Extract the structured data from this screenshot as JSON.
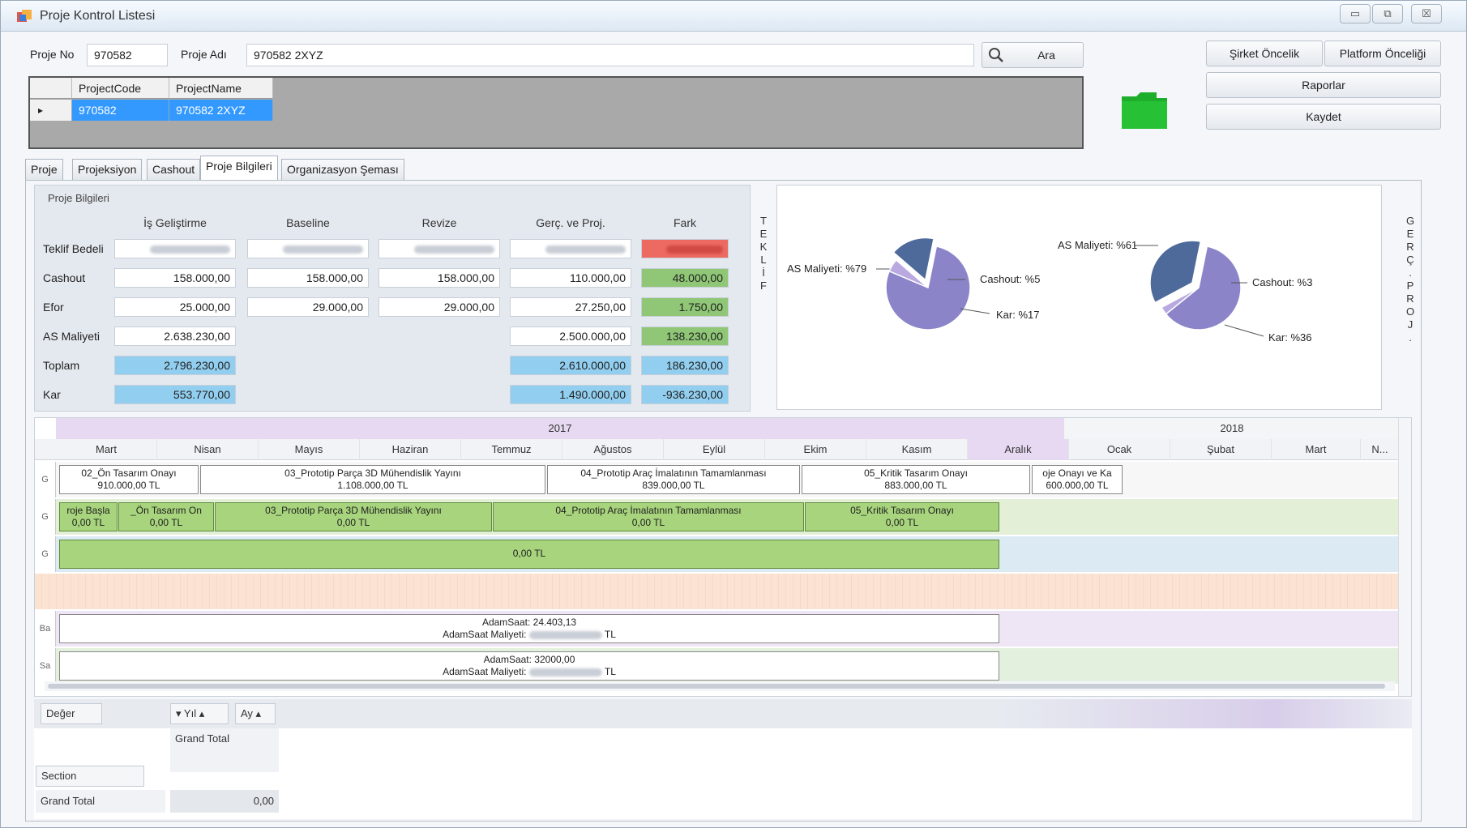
{
  "window": {
    "title": "Proje Kontrol Listesi",
    "controls": [
      "▭",
      "⧉",
      "☒"
    ]
  },
  "search": {
    "proje_no_label": "Proje No",
    "proje_no_value": "970582",
    "proje_adi_label": "Proje Adı",
    "proje_adi_value": "970582 2XYZ",
    "search_button": "Ara"
  },
  "right_buttons": {
    "sirket": "Şirket Öncelik",
    "platform": "Platform Önceliği",
    "raporlar": "Raporlar",
    "kaydet": "Kaydet"
  },
  "project_grid": {
    "columns": [
      "ProjectCode",
      "ProjectName"
    ],
    "rows": [
      [
        "970582",
        "970582 2XYZ"
      ]
    ]
  },
  "tabs": [
    "Proje",
    "Projeksiyon",
    "Cashout",
    "Proje Bilgileri",
    "Organizasyon Şeması"
  ],
  "active_tab": "Proje Bilgileri",
  "info": {
    "title": "Proje Bilgileri",
    "columns": [
      "İş Geliştirme",
      "Baseline",
      "Revize",
      "Gerç. ve Proj.",
      "Fark"
    ],
    "rows": [
      {
        "label": "Teklif Bedeli",
        "values": [
          "",
          "",
          "",
          "",
          ""
        ]
      },
      {
        "label": "Cashout",
        "values": [
          "158.000,00",
          "158.000,00",
          "158.000,00",
          "110.000,00",
          "48.000,00"
        ]
      },
      {
        "label": "Efor",
        "values": [
          "25.000,00",
          "29.000,00",
          "29.000,00",
          "27.250,00",
          "1.750,00"
        ]
      },
      {
        "label": "AS Maliyeti",
        "values": [
          "2.638.230,00",
          "",
          "",
          "2.500.000,00",
          "138.230,00"
        ]
      },
      {
        "label": "Toplam",
        "values": [
          "2.796.230,00",
          "",
          "",
          "2.610.000,00",
          "186.230,00"
        ]
      },
      {
        "label": "Kar",
        "values": [
          "553.770,00",
          "",
          "",
          "1.490.000,00",
          "-936.230,00"
        ]
      }
    ]
  },
  "side_labels": {
    "teklif": [
      "T",
      "E",
      "K",
      "L",
      "İ",
      "F"
    ],
    "gerc": [
      "G",
      "E",
      "R",
      "Ç",
      ".",
      "P",
      "R",
      "O",
      "J",
      "."
    ]
  },
  "pies": [
    {
      "slices": [
        {
          "label": "AS Maliyeti: %79",
          "value": 79,
          "color": "#8b84c9"
        },
        {
          "label": "Cashout: %5",
          "value": 5,
          "color": "#b9a9e0"
        },
        {
          "label": "Kar: %17",
          "value": 17,
          "color": "#4e6a9a"
        }
      ]
    },
    {
      "slices": [
        {
          "label": "AS Maliyeti: %61",
          "value": 61,
          "color": "#8b84c9"
        },
        {
          "label": "Cashout: %3",
          "value": 3,
          "color": "#b9a9e0"
        },
        {
          "label": "Kar: %36",
          "value": 36,
          "color": "#4e6a9a"
        }
      ]
    }
  ],
  "gantt": {
    "years": [
      "2017",
      "2018"
    ],
    "months": [
      "Mart",
      "Nisan",
      "Mayıs",
      "Haziran",
      "Temmuz",
      "Ağustos",
      "Eylül",
      "Ekim",
      "Kasım",
      "Aralık",
      "Ocak",
      "Şubat",
      "Mart",
      "N..."
    ],
    "row1": [
      {
        "name": "02_Ön Tasarım Onayı",
        "amount": "910.000,00 TL"
      },
      {
        "name": "03_Prototip Parça 3D Mühendislik Yayını",
        "amount": "1.108.000,00 TL"
      },
      {
        "name": "04_Prototip Araç İmalatının Tamamlanması",
        "amount": "839.000,00 TL"
      },
      {
        "name": "05_Kritik Tasarım Onayı",
        "amount": "883.000,00 TL"
      },
      {
        "name": "oje Onayı ve Ka",
        "amount": "600.000,00 TL"
      }
    ],
    "row2": [
      {
        "name": "roje Başla",
        "amount": "0,00 TL"
      },
      {
        "name": "_Ön Tasarım On",
        "amount": "0,00 TL"
      },
      {
        "name": "03_Prototip Parça 3D Mühendislik Yayını",
        "amount": "0,00 TL"
      },
      {
        "name": "04_Prototip Araç İmalatının Tamamlanması",
        "amount": "0,00 TL"
      },
      {
        "name": "05_Kritik Tasarım Onayı",
        "amount": "0,00 TL"
      }
    ],
    "row3": {
      "amount": "0,00 TL"
    },
    "row5": {
      "line1": "AdamSaat: 24.403,13",
      "line2_prefix": "AdamSaat Maliyeti:",
      "suffix": "TL"
    },
    "row6": {
      "line1": "AdamSaat: 32000,00",
      "line2_prefix": "AdamSaat Maliyeti:",
      "suffix": "TL"
    },
    "row_icons": [
      "G",
      "G",
      "G",
      "",
      "Ba",
      "Sa"
    ]
  },
  "pivot": {
    "data_field": "Değer",
    "col_field_1": "Yıl",
    "col_field_2": "Ay",
    "grand_total_col": "Grand Total",
    "row_field": "Section",
    "grand_total_row": "Grand Total",
    "grand_total_value": "0,00"
  }
}
